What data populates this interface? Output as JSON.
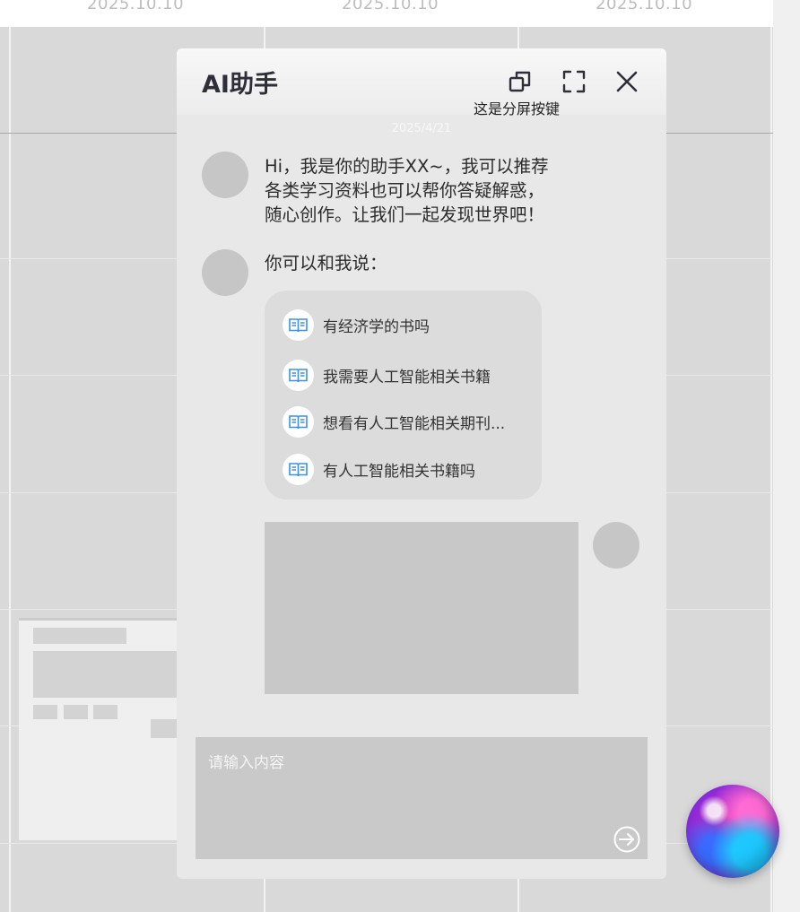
{
  "background": {
    "dates": [
      "2025.10.10",
      "2025.10.10",
      "2025.10.10"
    ]
  },
  "panel": {
    "title": "AI助手",
    "split_tooltip": "这是分屏按键",
    "message_date": "2025/4/21",
    "greeting_lines": [
      "Hi，我是你的助手XX~，我可以推荐",
      "各类学习资料也可以帮你答疑解惑，",
      "随心创作。让我们一起发现世界吧！"
    ],
    "prompt_intro": "你可以和我说：",
    "suggestions": [
      "有经济学的书吗",
      "我需要人工智能相关书籍",
      "想看有人工智能相关期刊...",
      "有人工智能相关书籍吗"
    ],
    "input_placeholder": "请输入内容"
  },
  "icons": {
    "split": "split-screen-icon",
    "fullscreen": "fullscreen-icon",
    "close": "close-icon",
    "suggestion": "book-icon",
    "send": "send-arrow-icon",
    "assistant": "ai-orb-icon"
  },
  "colors": {
    "book_icon": "#3d8fe6",
    "panel_bg": "#e8e8e8",
    "title": "#2f2f3a"
  }
}
